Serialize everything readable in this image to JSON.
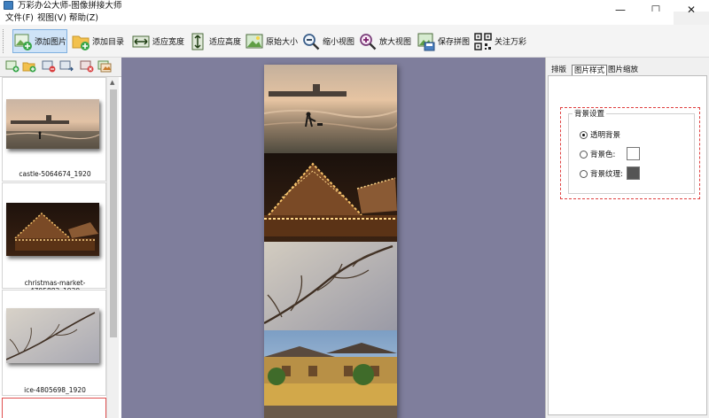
{
  "window": {
    "title": "万彩办公大师-图像拼接大师",
    "minimize_glyph": "—",
    "maximize_glyph": "☐",
    "close_glyph": "✕"
  },
  "menu": [
    "文件(F)",
    "视图(V)",
    "帮助(Z)"
  ],
  "toolbar": [
    {
      "label": "添加图片",
      "icon": "add-image-icon",
      "active": true
    },
    {
      "label": "添加目录",
      "icon": "add-folder-icon"
    },
    {
      "label": "适应宽度",
      "icon": "fit-width-icon"
    },
    {
      "label": "适应高度",
      "icon": "fit-height-icon"
    },
    {
      "label": "原始大小",
      "icon": "original-size-icon"
    },
    {
      "label": "缩小视图",
      "icon": "zoom-out-icon"
    },
    {
      "label": "放大视图",
      "icon": "zoom-in-icon"
    },
    {
      "label": "保存拼图",
      "icon": "save-icon"
    },
    {
      "label": "关注万彩",
      "icon": "qr-code-icon"
    }
  ],
  "thumbnails": [
    {
      "name": "castle-5064674_1920"
    },
    {
      "name": "christmas-market-4705882_1920"
    },
    {
      "name": "ice-4805698_1920"
    }
  ],
  "tabs": [
    {
      "label": "排版"
    },
    {
      "label": "图片样式",
      "active": true
    },
    {
      "label": "图片缩放"
    }
  ],
  "background_settings": {
    "group_title": "背景设置",
    "options": [
      {
        "label": "透明背景",
        "checked": true
      },
      {
        "label": "背景色:",
        "checked": false,
        "swatch": "#ffffff"
      },
      {
        "label": "背景纹理:",
        "checked": false,
        "swatch": "#555555"
      }
    ]
  },
  "colors": {
    "canvas_bg": "#7f7e9c",
    "highlight_dash": "#e04040",
    "active_tool": "#cfe3f7"
  }
}
